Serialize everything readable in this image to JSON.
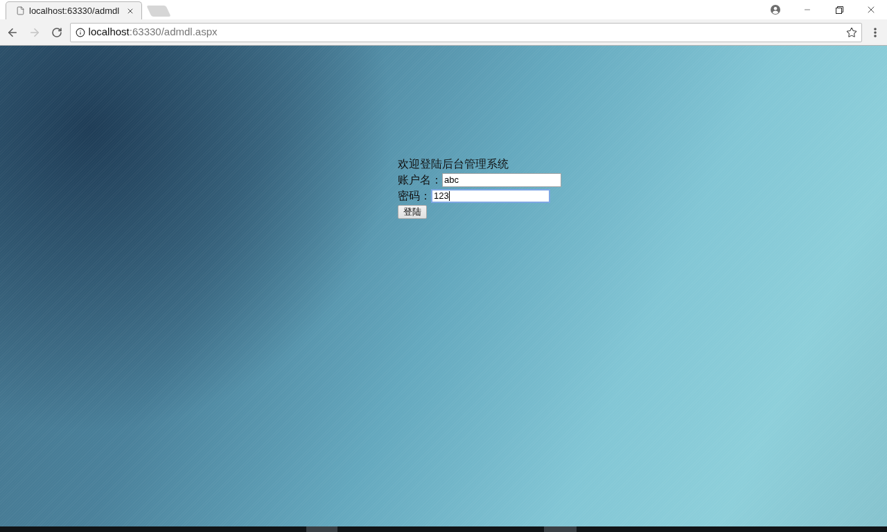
{
  "browser": {
    "tabs": [
      {
        "title": "localhost:63330/admdl",
        "selected": true
      }
    ],
    "navigation": {
      "back": {
        "disabled": false
      },
      "forward": {
        "disabled": true
      }
    },
    "address_bar": {
      "host": "localhost",
      "port_and_path": ":63330/admdl.aspx"
    }
  },
  "login_form": {
    "heading": "欢迎登陆后台管理系统",
    "fields": [
      {
        "label": "账户名：",
        "value": "abc",
        "focused": false
      },
      {
        "label": "密码：",
        "value": "123",
        "focused": true
      }
    ],
    "submit_button": "登陆"
  }
}
